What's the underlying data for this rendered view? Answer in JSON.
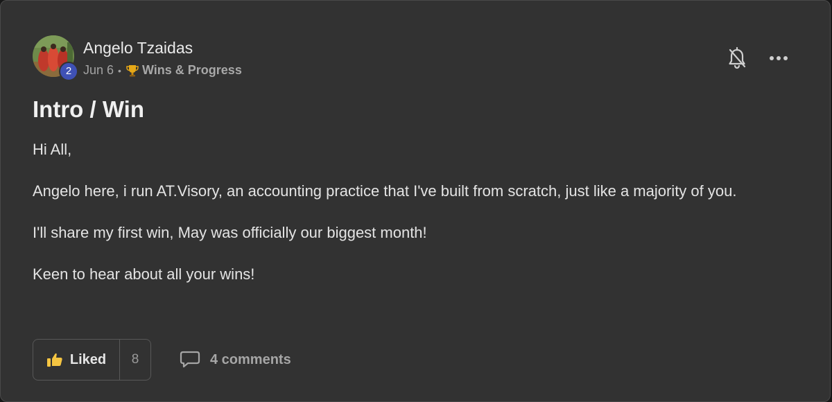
{
  "post": {
    "author": "Angelo Tzaidas",
    "level": "2",
    "date": "Jun 6",
    "separator": "•",
    "category": "Wins & Progress",
    "category_icon": "trophy-icon",
    "title": "Intro / Win",
    "paragraphs": [
      "Hi All,",
      "Angelo here, i run AT.Visory, an accounting practice that I've built from scratch, just like a majority of you.",
      "I'll share my first win, May was officially our biggest month!",
      "Keen to hear about all your wins!"
    ]
  },
  "actions": {
    "like_label": "Liked",
    "like_count": "8",
    "comments_label": "4 comments",
    "notification_icon": "bell-off-icon",
    "more_icon": "more-horizontal-icon"
  },
  "colors": {
    "card_background": "#323232",
    "text": "#e4e4e4",
    "muted_text": "#a3a3a3",
    "level_badge": "#3f51b5",
    "liked_thumb": "#f5c542"
  }
}
